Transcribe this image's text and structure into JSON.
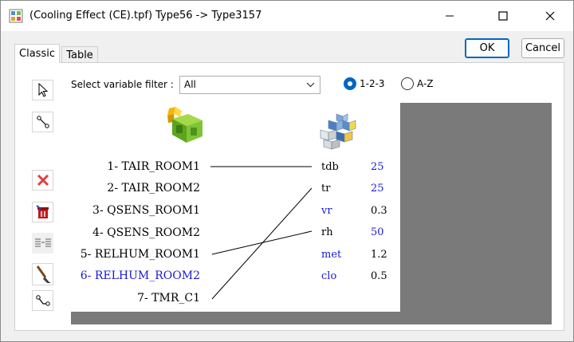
{
  "window": {
    "title": "(Cooling Effect (CE).tpf) Type56 -> Type3157"
  },
  "buttons": {
    "ok": "OK",
    "cancel": "Cancel"
  },
  "tabs": [
    {
      "label": "Classic",
      "active": true
    },
    {
      "label": "Table",
      "active": false
    }
  ],
  "filter": {
    "label": "Select variable filter :",
    "value": "All"
  },
  "sort": {
    "options": [
      "1-2-3",
      "A-Z"
    ],
    "selected": "1-2-3"
  },
  "outputs": [
    {
      "label": "1- TAIR_ROOM1",
      "color": "#000000"
    },
    {
      "label": "2- TAIR_ROOM2",
      "color": "#000000"
    },
    {
      "label": "3- QSENS_ROOM1",
      "color": "#000000"
    },
    {
      "label": "4- QSENS_ROOM2",
      "color": "#000000"
    },
    {
      "label": "5- RELHUM_ROOM1",
      "color": "#000000"
    },
    {
      "label": "6- RELHUM_ROOM2",
      "color": "#1a1ad6"
    },
    {
      "label": "7- TMR_C1",
      "color": "#000000"
    }
  ],
  "inputs": [
    {
      "name": "tdb",
      "value": "25",
      "name_color": "#000000",
      "value_color": "#1a1ad6"
    },
    {
      "name": "tr",
      "value": "25",
      "name_color": "#000000",
      "value_color": "#1a1ad6"
    },
    {
      "name": "vr",
      "value": "0.3",
      "name_color": "#1a1ad6",
      "value_color": "#000000"
    },
    {
      "name": "rh",
      "value": "50",
      "name_color": "#000000",
      "value_color": "#1a1ad6"
    },
    {
      "name": "met",
      "value": "1.2",
      "name_color": "#1a1ad6",
      "value_color": "#000000"
    },
    {
      "name": "clo",
      "value": "0.5",
      "name_color": "#1a1ad6",
      "value_color": "#000000"
    }
  ],
  "connections": [
    {
      "from": "1- TAIR_ROOM1",
      "to": "tdb"
    },
    {
      "from": "5- RELHUM_ROOM1",
      "to": "rh"
    },
    {
      "from": "7- TMR_C1",
      "to": "tr"
    }
  ],
  "icons": {
    "app": "app-window-icon",
    "source_component": "green-cube-icon",
    "target_component": "blue-cubes-icon",
    "tools": [
      "pointer-icon",
      "link-icon",
      "delete-icon",
      "delete-all-icon",
      "align-icon",
      "brush-icon",
      "auto-link-icon"
    ]
  },
  "colors": {
    "accent": "#0067c0",
    "canvas_bg": "#7a7a7a",
    "highlight_blue": "#1a1ad6"
  }
}
